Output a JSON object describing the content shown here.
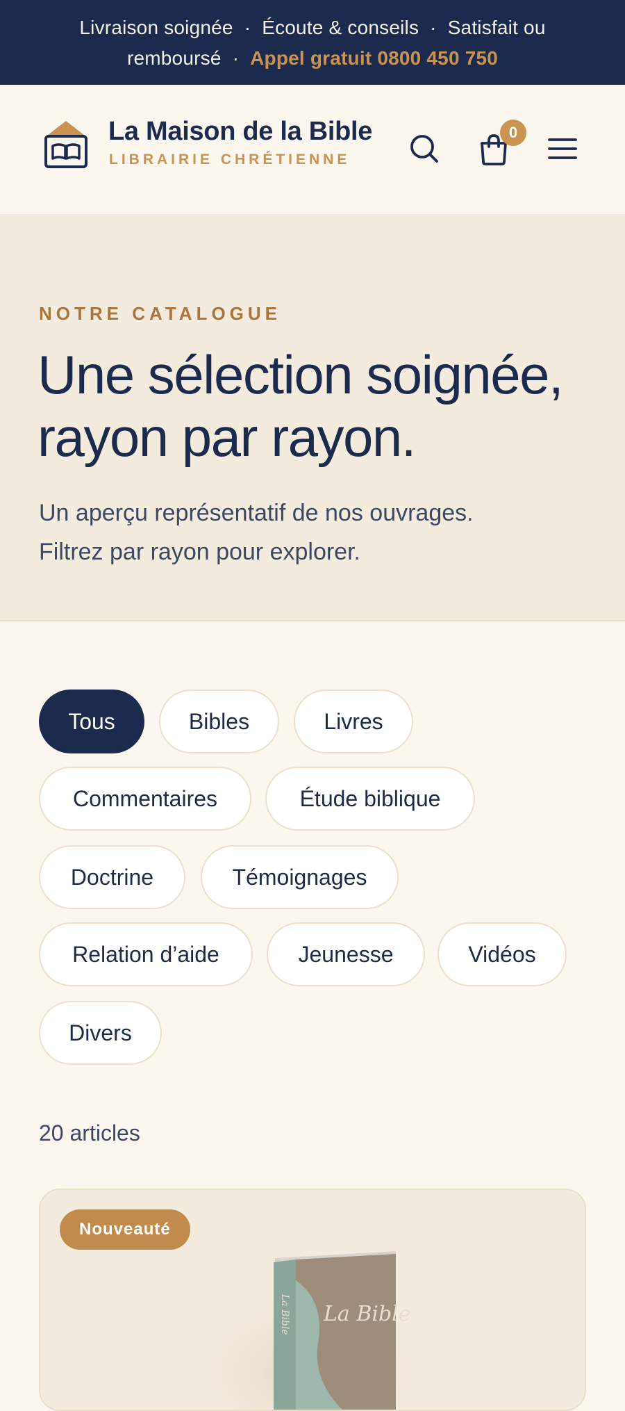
{
  "topbar": {
    "item1": "Livraison soignée",
    "item2": "Écoute & conseils",
    "item3": "Satisfait ou remboursé",
    "separator": "·",
    "phone": "Appel gratuit 0800 450 750"
  },
  "brand": {
    "name": "La Maison de la Bible",
    "tagline": "LIBRAIRIE CHRÉTIENNE"
  },
  "header": {
    "icons": [
      "search-icon",
      "cart-icon",
      "menu-icon"
    ],
    "cart_count": "0"
  },
  "hero": {
    "eyebrow": "NOTRE CATALOGUE",
    "title_line1": "Une sélection soignée,",
    "title_line2": "rayon par rayon.",
    "subtitle_line1": "Un aperçu représentatif de nos ouvrages.",
    "subtitle_line2": "Filtrez par rayon pour explorer."
  },
  "filters": [
    {
      "label": "Tous",
      "active": true
    },
    {
      "label": "Bibles",
      "active": false
    },
    {
      "label": "Livres",
      "active": false
    },
    {
      "label": "Commentaires",
      "active": false
    },
    {
      "label": "Étude biblique",
      "active": false
    },
    {
      "label": "Doctrine",
      "active": false
    },
    {
      "label": "Témoignages",
      "active": false
    },
    {
      "label": "Relation d’aide",
      "active": false
    },
    {
      "label": "Jeunesse",
      "active": false
    },
    {
      "label": "Vidéos",
      "active": false
    },
    {
      "label": "Divers",
      "active": false
    }
  ],
  "results": {
    "count_label": "20 articles"
  },
  "product": {
    "badge": "Nouveauté",
    "cover_title": "La Bible",
    "spine_title": "La Bible"
  },
  "colors": {
    "navy": "#1b2a4d",
    "gold": "#c99451",
    "cream": "#fbf6ee",
    "sand": "#f3ebde"
  }
}
